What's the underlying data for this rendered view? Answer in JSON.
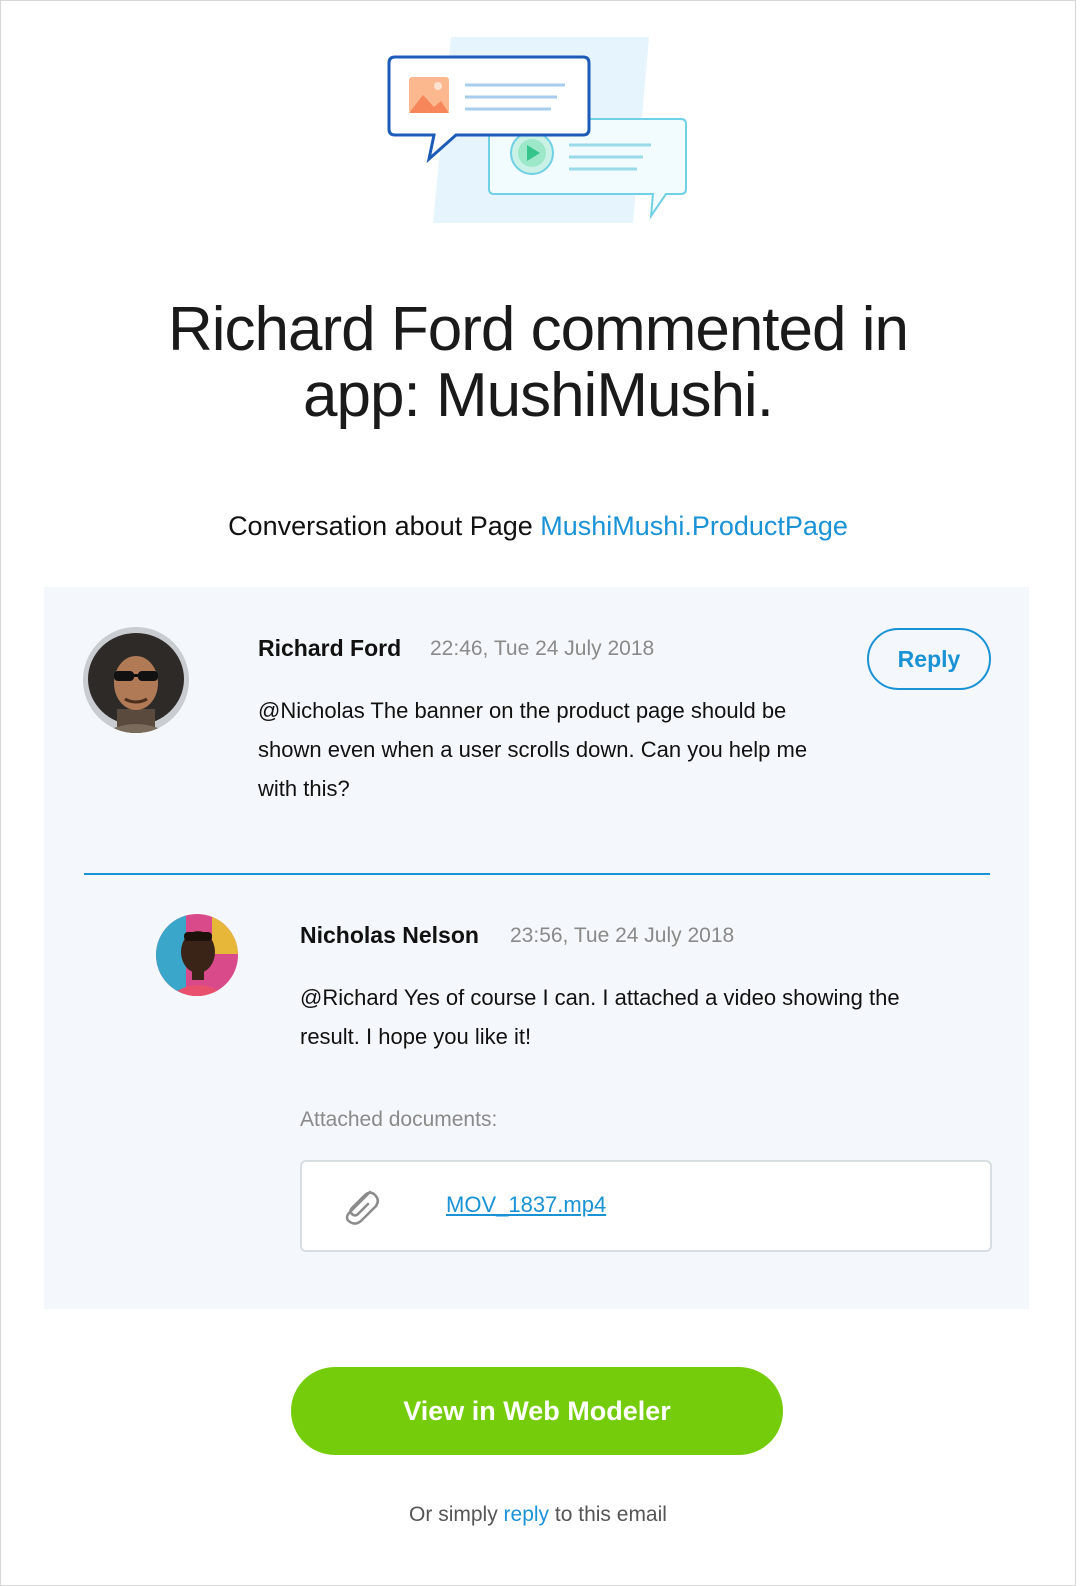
{
  "headline": {
    "line1": "Richard Ford commented in",
    "line2": "app: MushiMushi."
  },
  "subtitle": {
    "prefix": "Conversation about Page ",
    "link": "MushiMushi.ProductPage"
  },
  "comments": [
    {
      "author": "Richard Ford",
      "timestamp": "22:46, Tue 24 July 2018",
      "lines": [
        "@Nicholas The banner on the product page should be",
        "shown even when a user scrolls down. Can you help me",
        "with this?"
      ],
      "reply_label": "Reply"
    },
    {
      "author": "Nicholas Nelson",
      "timestamp": "23:56, Tue 24 July 2018",
      "lines": [
        "@Richard Yes of course I can. I attached a video showing the",
        "result. I hope you like it!"
      ],
      "attached_label": "Attached documents:",
      "attachment": "MOV_1837.mp4"
    }
  ],
  "cta_label": "View in Web Modeler",
  "footer": {
    "prefix": "Or simply ",
    "link": "reply",
    "suffix": " to this email"
  },
  "colors": {
    "accent": "#1a92d6",
    "cta": "#74cc0a",
    "thread_bg": "#f4f7fb"
  }
}
